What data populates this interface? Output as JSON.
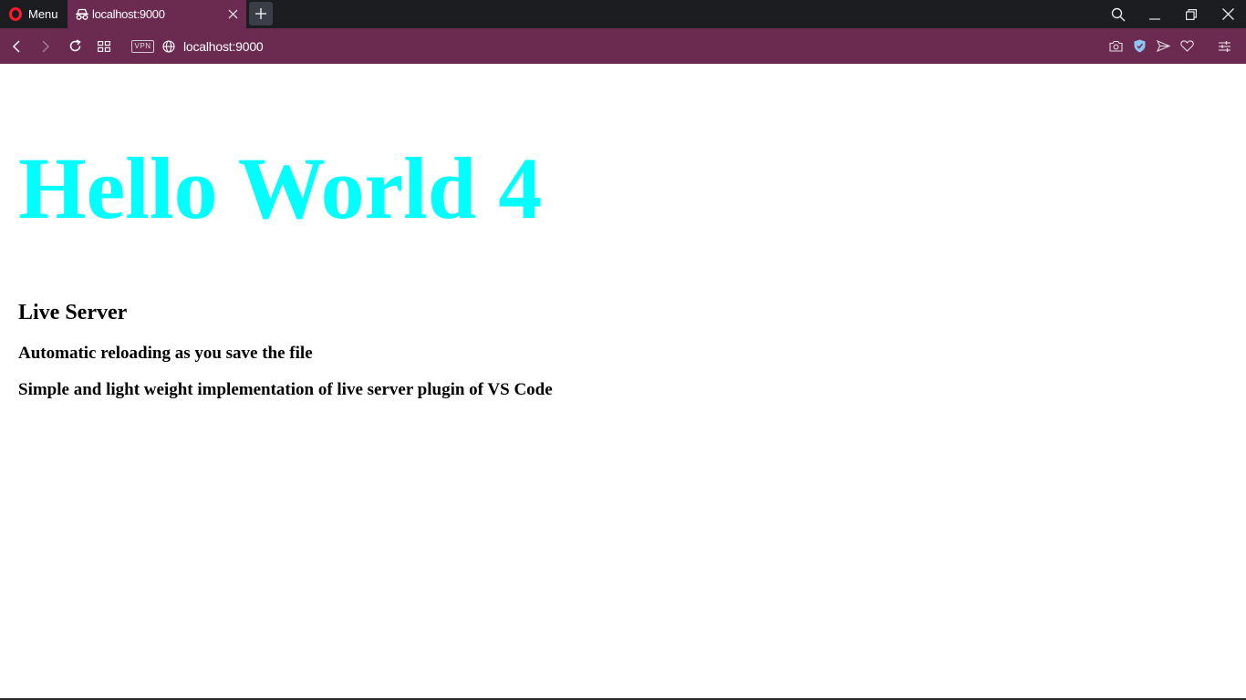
{
  "browser": {
    "menu_label": "Menu",
    "tabs": [
      {
        "title": "localhost:9000",
        "icon": "incognito-icon",
        "active": true
      }
    ],
    "address": {
      "url": "localhost:9000",
      "vpn_label": "VPN"
    },
    "colors": {
      "tabstrip": "#1b1d21",
      "accent": "#6b2b50",
      "opera_red": "#ff1b2d",
      "shield": "#8ec5f3"
    }
  },
  "page": {
    "heading": "Hello World 4",
    "subheading": "Live Server",
    "lines": [
      "Automatic reloading as you save the file",
      "Simple and light weight implementation of live server plugin of VS Code"
    ],
    "heading_color": "#00ffff"
  }
}
